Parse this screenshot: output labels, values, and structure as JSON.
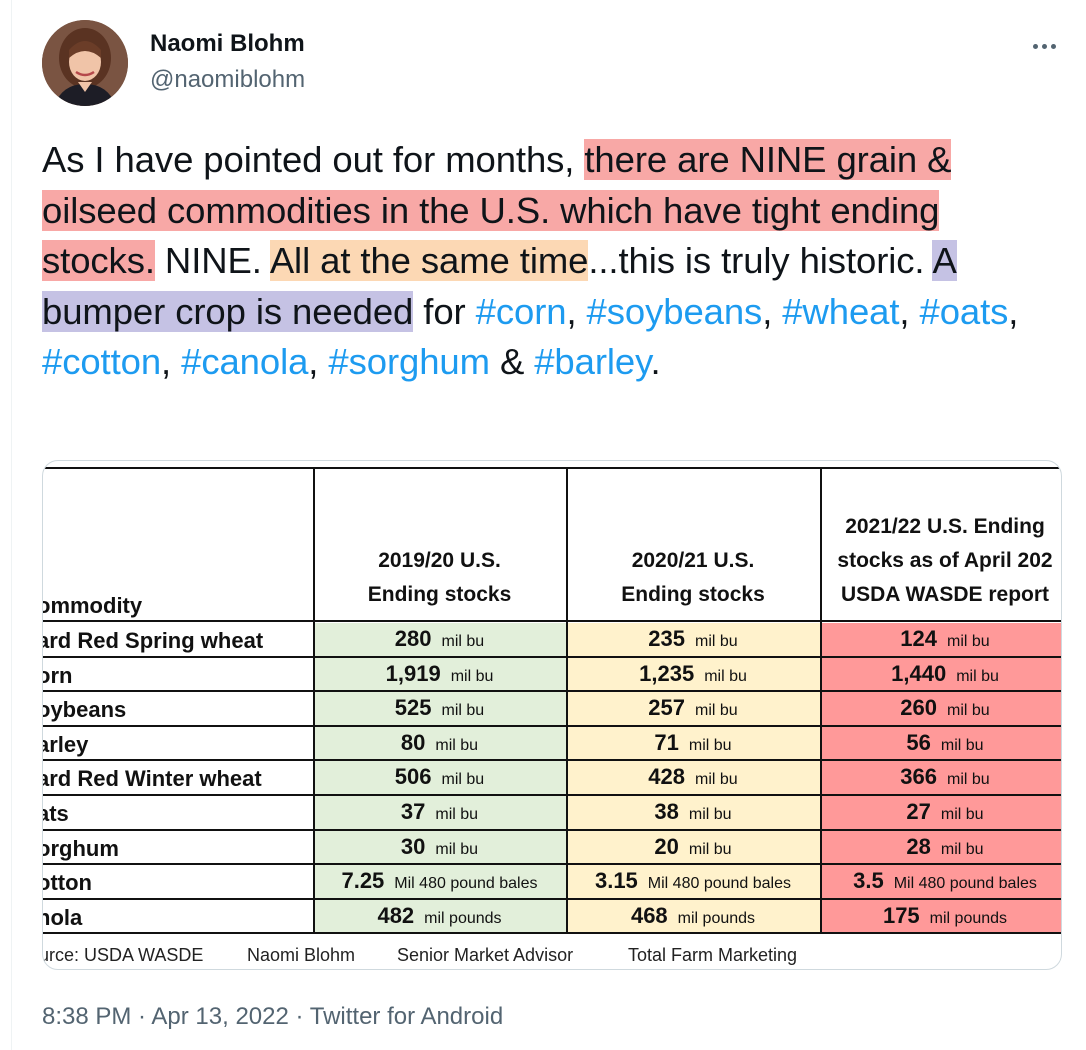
{
  "author": {
    "display_name": "Naomi Blohm",
    "handle": "@naomiblohm",
    "avatar_icon": "profile-photo"
  },
  "tweet": {
    "segments": [
      {
        "text": "As I have pointed out for months, ",
        "style": "plain"
      },
      {
        "text": "there are NINE grain & oilseed commodities in the U.S. which have tight ending stocks.",
        "style": "red"
      },
      {
        "text": " NINE. ",
        "style": "plain"
      },
      {
        "text": "All at the same time",
        "style": "orange"
      },
      {
        "text": "...this is truly historic. ",
        "style": "plain"
      },
      {
        "text": "A bumper crop is needed",
        "style": "purple"
      },
      {
        "text": " for ",
        "style": "plain"
      },
      {
        "text": "#corn",
        "style": "hashtag"
      },
      {
        "text": ", ",
        "style": "plain"
      },
      {
        "text": "#soybeans",
        "style": "hashtag"
      },
      {
        "text": ", ",
        "style": "plain"
      },
      {
        "text": "#wheat",
        "style": "hashtag"
      },
      {
        "text": ", ",
        "style": "plain"
      },
      {
        "text": "#oats",
        "style": "hashtag"
      },
      {
        "text": ", ",
        "style": "plain"
      },
      {
        "text": "#cotton",
        "style": "hashtag"
      },
      {
        "text": ", ",
        "style": "plain"
      },
      {
        "text": "#canola",
        "style": "hashtag"
      },
      {
        "text": ", ",
        "style": "plain"
      },
      {
        "text": "#sorghum",
        "style": "hashtag"
      },
      {
        "text": " & ",
        "style": "plain"
      },
      {
        "text": "#barley",
        "style": "hashtag"
      },
      {
        "text": ".",
        "style": "plain"
      }
    ]
  },
  "table": {
    "commodity_header": "ommodity",
    "columns": [
      {
        "header_lines": [
          "2019/20  U.S.",
          "Ending stocks"
        ],
        "color": "#e2efda"
      },
      {
        "header_lines": [
          "2020/21 U.S.",
          "Ending stocks"
        ],
        "color": "#fff2cc"
      },
      {
        "header_lines": [
          "2021/22 U.S. Ending",
          "stocks as of April 202",
          "USDA WASDE report"
        ],
        "color": "#ff9999"
      }
    ],
    "rows": [
      {
        "name": "ard Red Spring wheat",
        "values": [
          [
            "280",
            "mil bu"
          ],
          [
            "235",
            "mil bu"
          ],
          [
            "124",
            "mil bu"
          ]
        ]
      },
      {
        "name": "orn",
        "values": [
          [
            "1,919",
            "mil bu"
          ],
          [
            "1,235",
            "mil bu"
          ],
          [
            "1,440",
            "mil bu"
          ]
        ]
      },
      {
        "name": "oybeans",
        "values": [
          [
            "525",
            "mil bu"
          ],
          [
            "257",
            "mil bu"
          ],
          [
            "260",
            "mil bu"
          ]
        ]
      },
      {
        "name": "arley",
        "values": [
          [
            "80",
            "mil bu"
          ],
          [
            "71",
            "mil bu"
          ],
          [
            "56",
            "mil bu"
          ]
        ]
      },
      {
        "name": "ard Red Winter wheat",
        "values": [
          [
            "506",
            "mil bu"
          ],
          [
            "428",
            "mil bu"
          ],
          [
            "366",
            "mil bu"
          ]
        ]
      },
      {
        "name": "ats",
        "values": [
          [
            "37",
            "mil bu"
          ],
          [
            "38",
            "mil bu"
          ],
          [
            "27",
            "mil bu"
          ]
        ]
      },
      {
        "name": "orghum",
        "values": [
          [
            "30",
            "mil bu"
          ],
          [
            "20",
            "mil bu"
          ],
          [
            "28",
            "mil bu"
          ]
        ]
      },
      {
        "name": "otton",
        "values": [
          [
            "7.25",
            "Mil 480 pound bales"
          ],
          [
            "3.15",
            "Mil 480 pound bales"
          ],
          [
            "3.5",
            "Mil 480 pound bales"
          ]
        ]
      },
      {
        "name": "nola",
        "values": [
          [
            "482",
            "mil pounds"
          ],
          [
            "468",
            "mil pounds"
          ],
          [
            "175",
            "mil pounds"
          ]
        ]
      }
    ],
    "source_items": [
      "urce: USDA WASDE",
      "Naomi Blohm",
      "Senior Market Advisor",
      "Total Farm Marketing"
    ]
  },
  "meta": {
    "time": "8:38 PM",
    "separator": " · ",
    "date": "Apr 13, 2022",
    "client": "Twitter for Android"
  }
}
